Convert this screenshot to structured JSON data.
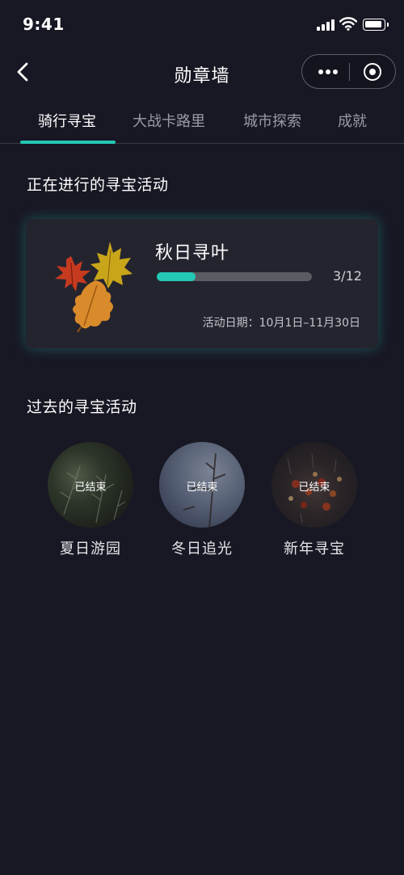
{
  "status_bar": {
    "time": "9:41",
    "icons": [
      "signal-icon",
      "wifi-icon",
      "battery-icon"
    ]
  },
  "nav": {
    "title": "勋章墙",
    "icons": [
      "chevron-left-icon",
      "more-dots-icon",
      "target-circle-icon"
    ]
  },
  "tabs": [
    {
      "label": "骑行寻宝",
      "active": true
    },
    {
      "label": "大战卡路里",
      "active": false
    },
    {
      "label": "城市探索",
      "active": false
    },
    {
      "label": "成就",
      "active": false
    }
  ],
  "current": {
    "section_title": "正在进行的寻宝活动",
    "activity": {
      "title": "秋日寻叶",
      "progress_text": "3/12",
      "progress_fraction": 0.25,
      "date": "活动日期：10月1日–11月30日",
      "image_icon": "autumn-leaves-icon"
    }
  },
  "past": {
    "section_title": "过去的寻宝活动",
    "items": [
      {
        "name": "夏日游园",
        "badge": "已结束"
      },
      {
        "name": "冬日追光",
        "badge": "已结束"
      },
      {
        "name": "新年寻宝",
        "badge": "已结束"
      }
    ]
  },
  "colors": {
    "background": "#181824",
    "card": "#24242f",
    "accent": "#24c8b4",
    "track": "#5b5b64"
  }
}
